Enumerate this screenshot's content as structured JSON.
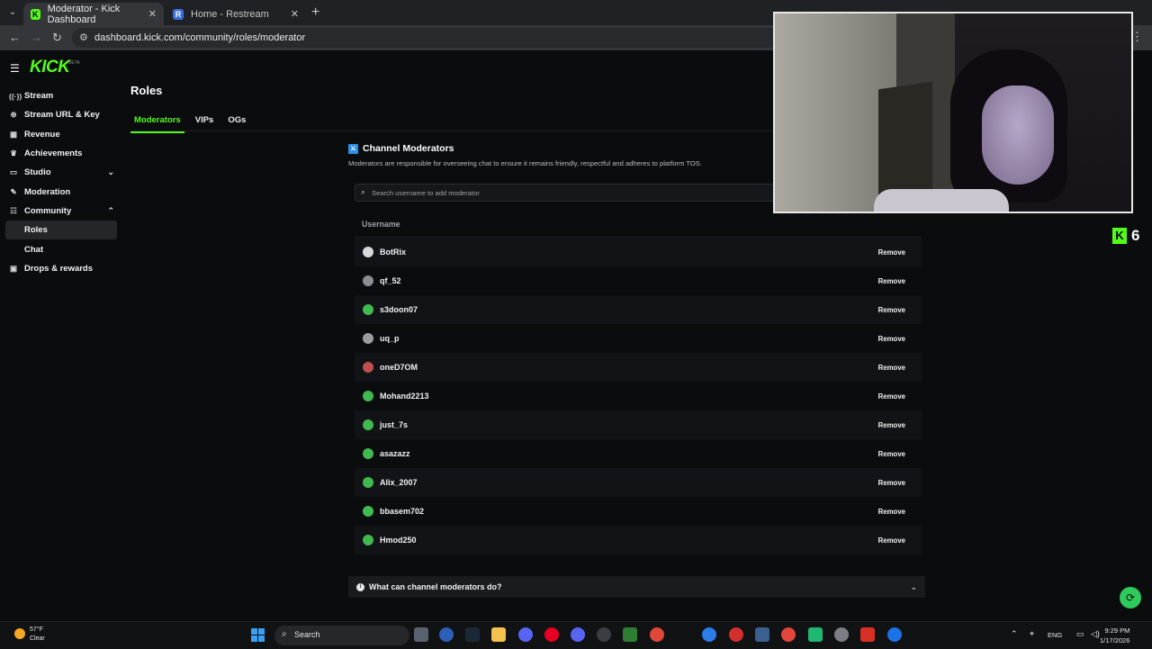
{
  "browser": {
    "tabs": [
      {
        "title": "Moderator - Kick Dashboard",
        "active": true,
        "favicon": "kick-favicon"
      },
      {
        "title": "Home - Restream",
        "active": false,
        "favicon": "restream-favicon"
      }
    ],
    "url": "dashboard.kick.com/community/roles/moderator"
  },
  "brand": {
    "logo_text": "KICK",
    "beta_label": "BETA",
    "accent": "#53fc18"
  },
  "sidebar": {
    "items": [
      {
        "label": "Stream",
        "icon": "signal-icon"
      },
      {
        "label": "Stream URL & Key",
        "icon": "key-icon"
      },
      {
        "label": "Revenue",
        "icon": "chart-icon"
      },
      {
        "label": "Achievements",
        "icon": "trophy-icon"
      },
      {
        "label": "Studio",
        "icon": "studio-icon",
        "expandable": true,
        "expanded": false
      },
      {
        "label": "Moderation",
        "icon": "wrench-icon"
      },
      {
        "label": "Community",
        "icon": "people-icon",
        "expandable": true,
        "expanded": true
      }
    ],
    "sub_items": [
      {
        "label": "Roles",
        "active": true
      },
      {
        "label": "Chat",
        "active": false
      }
    ],
    "last_item": {
      "label": "Drops & rewards",
      "icon": "gift-icon"
    }
  },
  "main": {
    "title": "Roles",
    "tabs": [
      {
        "label": "Moderators",
        "active": true
      },
      {
        "label": "VIPs",
        "active": false
      },
      {
        "label": "OGs",
        "active": false
      }
    ],
    "section_title": "Channel Moderators",
    "section_desc": "Moderators are responsible for overseeing chat to ensure it remains friendly, respectful and adheres to platform TOS.",
    "search_placeholder": "Search username to add moderator",
    "column_header": "Username",
    "remove_label": "Remove",
    "moderators": [
      {
        "name": "BotRix",
        "avatar_color": "#d9d9d9"
      },
      {
        "name": "qf_52",
        "avatar_color": "#8a8d91"
      },
      {
        "name": "s3doon07",
        "avatar_color": "#3fb950"
      },
      {
        "name": "uq_p",
        "avatar_color": "#9a9ca0"
      },
      {
        "name": "oneD7OM",
        "avatar_color": "#c0504d"
      },
      {
        "name": "Mohand2213",
        "avatar_color": "#3fb950"
      },
      {
        "name": "just_7s",
        "avatar_color": "#3fb950"
      },
      {
        "name": "asazazz",
        "avatar_color": "#3fb950"
      },
      {
        "name": "Alix_2007",
        "avatar_color": "#3fb950"
      },
      {
        "name": "bbasem702",
        "avatar_color": "#3fb950"
      },
      {
        "name": "Hmod250",
        "avatar_color": "#3fb950"
      }
    ],
    "faq_question": "What can channel moderators do?"
  },
  "overlay": {
    "badge_number": "6"
  },
  "taskbar": {
    "weather_temp": "57°F",
    "weather_desc": "Clear",
    "search_label": "Search",
    "lang": "ENG",
    "time": "9:29 PM",
    "date": "1/17/2026"
  }
}
